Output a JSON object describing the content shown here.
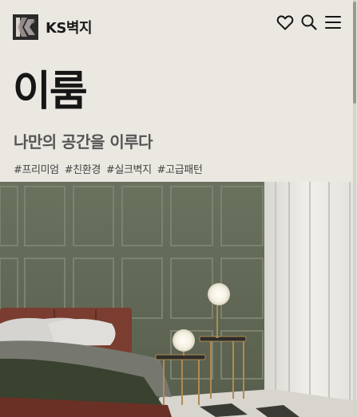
{
  "header": {
    "brand": "KS벽지",
    "logo_icon": "ks-logo-icon",
    "icons": [
      "heart-icon",
      "search-icon",
      "menu-icon"
    ]
  },
  "hero": {
    "title": "이룸",
    "subtitle": "나만의 공간을 이루다",
    "tags": [
      "#프리미엄",
      "#친환경",
      "#실크벽지",
      "#고급패턴"
    ]
  },
  "colors": {
    "background": "#ebe8e2",
    "wall_green": "#6e7562",
    "bed_red": "#7a3d2f"
  }
}
